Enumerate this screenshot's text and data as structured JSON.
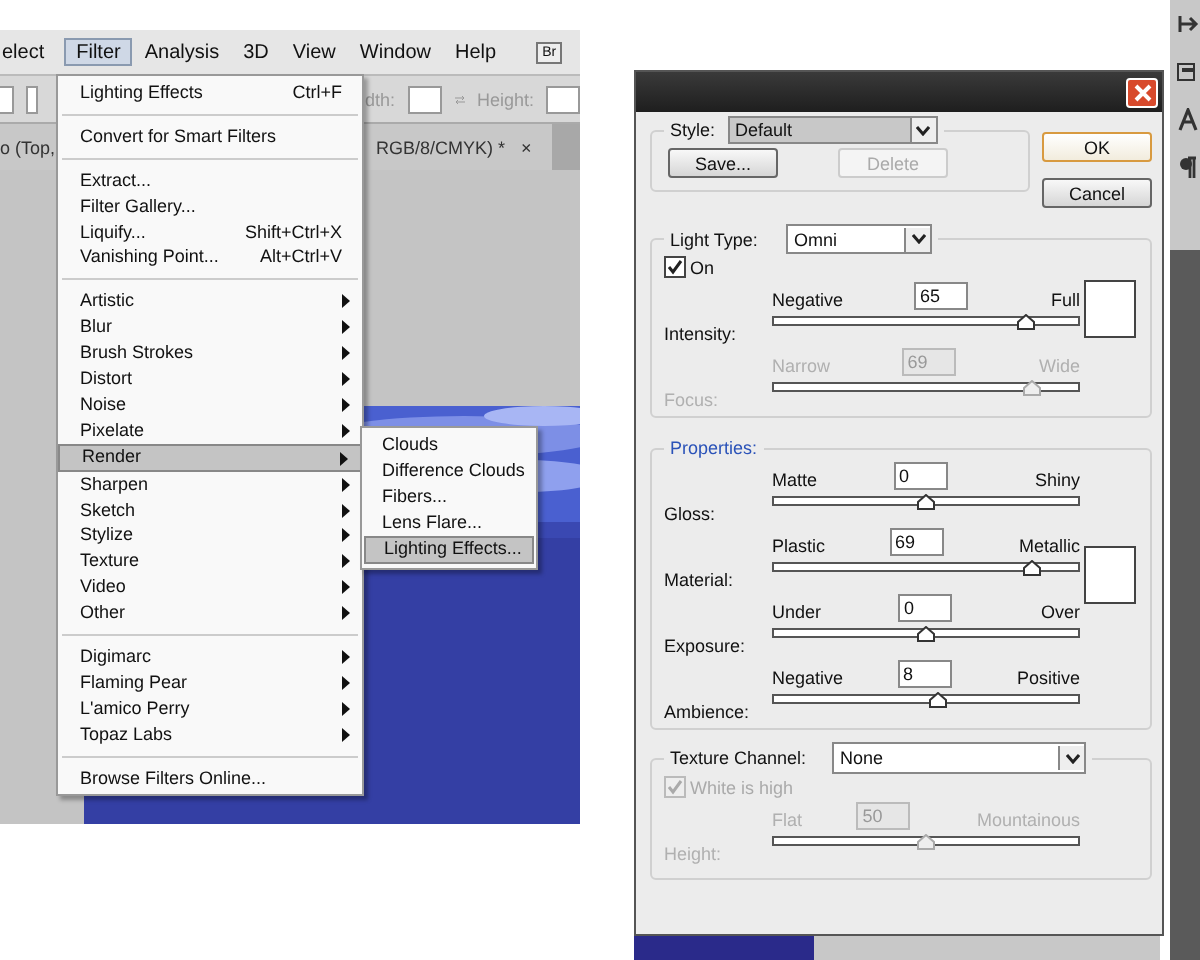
{
  "left_screen": {
    "menu_bar": [
      {
        "label": "elect",
        "selected": false
      },
      {
        "label": "Filter",
        "selected": true
      },
      {
        "label": "Analysis",
        "selected": false
      },
      {
        "label": "3D",
        "selected": false
      },
      {
        "label": "View",
        "selected": false
      },
      {
        "label": "Window",
        "selected": false
      },
      {
        "label": "Help",
        "selected": false
      }
    ],
    "bridge_button": "Br",
    "options_bar": {
      "width_label": "dth:",
      "height_label": "Height:"
    },
    "document_tabs": [
      {
        "label": "o (Top,"
      },
      {
        "label": "RGB/8/CMYK) *",
        "close": "×"
      }
    ],
    "filter_menu": [
      [
        {
          "label": "Lighting Effects",
          "shortcut": "Ctrl+F",
          "submenu": false,
          "selected": false
        }
      ],
      [
        {
          "label": "Convert for Smart Filters",
          "submenu": false,
          "selected": false
        }
      ],
      [
        {
          "label": "Extract...",
          "submenu": false,
          "selected": false
        },
        {
          "label": "Filter Gallery...",
          "submenu": false,
          "selected": false
        },
        {
          "label": "Liquify...",
          "shortcut": "Shift+Ctrl+X",
          "submenu": false,
          "selected": false
        },
        {
          "label": "Vanishing Point...",
          "shortcut": "Alt+Ctrl+V",
          "submenu": false,
          "selected": false
        }
      ],
      [
        {
          "label": "Artistic",
          "submenu": true,
          "selected": false
        },
        {
          "label": "Blur",
          "submenu": true,
          "selected": false
        },
        {
          "label": "Brush Strokes",
          "submenu": true,
          "selected": false
        },
        {
          "label": "Distort",
          "submenu": true,
          "selected": false
        },
        {
          "label": "Noise",
          "submenu": true,
          "selected": false
        },
        {
          "label": "Pixelate",
          "submenu": true,
          "selected": false
        },
        {
          "label": "Render",
          "submenu": true,
          "selected": true
        },
        {
          "label": "Sharpen",
          "submenu": true,
          "selected": false
        },
        {
          "label": "Sketch",
          "submenu": true,
          "selected": false
        },
        {
          "label": "Stylize",
          "submenu": true,
          "selected": false
        },
        {
          "label": "Texture",
          "submenu": true,
          "selected": false
        },
        {
          "label": "Video",
          "submenu": true,
          "selected": false
        },
        {
          "label": "Other",
          "submenu": true,
          "selected": false
        }
      ],
      [
        {
          "label": "Digimarc",
          "submenu": true,
          "selected": false
        },
        {
          "label": "Flaming Pear",
          "submenu": true,
          "selected": false
        },
        {
          "label": "L'amico Perry",
          "submenu": true,
          "selected": false
        },
        {
          "label": "Topaz Labs",
          "submenu": true,
          "selected": false
        }
      ],
      [
        {
          "label": "Browse Filters Online...",
          "submenu": false,
          "selected": false
        }
      ]
    ],
    "render_submenu": [
      {
        "label": "Clouds",
        "selected": false
      },
      {
        "label": "Difference Clouds",
        "selected": false
      },
      {
        "label": "Fibers...",
        "selected": false
      },
      {
        "label": "Lens Flare...",
        "selected": false
      },
      {
        "label": "Lighting Effects...",
        "selected": true
      }
    ]
  },
  "dialog": {
    "style": {
      "label": "Style:",
      "value": "Default"
    },
    "style_buttons": [
      {
        "label": "Save...",
        "disabled": false
      },
      {
        "label": "Delete",
        "disabled": true
      }
    ],
    "side_buttons": [
      {
        "label": "OK",
        "default": true
      },
      {
        "label": "Cancel",
        "default": false
      }
    ],
    "light_type": {
      "label": "Light Type:",
      "value": "Omni"
    },
    "on": {
      "label": "On",
      "checked": true,
      "disabled": false
    },
    "light_sliders": [
      {
        "label": "Intensity:",
        "min_label": "Negative",
        "max_label": "Full",
        "value": "65",
        "level": 0.83,
        "disabled": false
      },
      {
        "label": "Focus:",
        "min_label": "Narrow",
        "max_label": "Wide",
        "value": "69",
        "level": 0.85,
        "disabled": true
      }
    ],
    "properties": {
      "title": "Properties:",
      "sliders": [
        {
          "label": "Gloss:",
          "min_label": "Matte",
          "max_label": "Shiny",
          "value": "0",
          "level": 0.5,
          "disabled": false
        },
        {
          "label": "Material:",
          "min_label": "Plastic",
          "max_label": "Metallic",
          "value": "69",
          "level": 0.85,
          "disabled": false
        },
        {
          "label": "Exposure:",
          "min_label": "Under",
          "max_label": "Over",
          "value": "0",
          "level": 0.5,
          "disabled": false
        },
        {
          "label": "Ambience:",
          "min_label": "Negative",
          "max_label": "Positive",
          "value": "8",
          "level": 0.54,
          "disabled": false
        }
      ]
    },
    "texture": {
      "label": "Texture Channel:",
      "value": "None",
      "white_is_high": {
        "label": "White is high",
        "checked": true,
        "disabled": true
      },
      "sliders": [
        {
          "label": "Height:",
          "min_label": "Flat",
          "max_label": "Mountainous",
          "value": "50",
          "level": 0.5,
          "disabled": true
        }
      ]
    }
  }
}
